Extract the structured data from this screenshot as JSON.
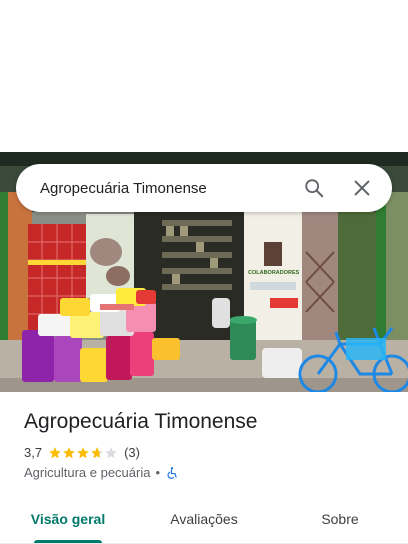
{
  "search": {
    "query": "Agropecuária Timonense"
  },
  "photo": {
    "sign_text": "COLABORADORES"
  },
  "place": {
    "name": "Agropecuária Timonense",
    "rating": "3,7",
    "stars": 3.7,
    "review_count": "(3)",
    "category": "Agricultura e pecuária",
    "separator": "•"
  },
  "tabs": [
    {
      "label": "Visão geral",
      "active": true
    },
    {
      "label": "Avaliações",
      "active": false
    },
    {
      "label": "Sobre",
      "active": false
    }
  ],
  "colors": {
    "accent": "#00796b",
    "star": "#fbbc04",
    "star_empty": "#dadce0",
    "accessibility": "#1a73e8"
  }
}
